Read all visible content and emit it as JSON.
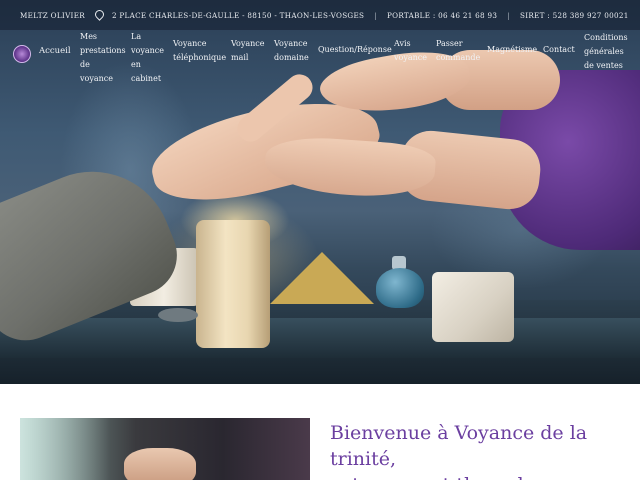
{
  "topbar": {
    "name": "MELTZ OLIVIER",
    "address": "2 PLACE CHARLES-DE-GAULLE - 88150 - THAON-LES-VOSGES",
    "phone": "PORTABLE : 06 46 21 68 93",
    "siret": "SIRET : 528 389 927 00021"
  },
  "nav": {
    "home": "Accueil",
    "items": [
      {
        "lines": [
          "Mes",
          "prestations",
          "de",
          "voyance"
        ]
      },
      {
        "lines": [
          "La",
          "voyance",
          "en",
          "cabinet"
        ]
      },
      {
        "lines": [
          "Voyance",
          "téléphonique"
        ]
      },
      {
        "lines": [
          "Voyance",
          "mail"
        ]
      },
      {
        "lines": [
          "Voyance",
          "domaine"
        ]
      },
      {
        "lines": [
          "Question/Réponse"
        ]
      },
      {
        "lines": [
          "Avis",
          "voyance"
        ]
      },
      {
        "lines": [
          "Passer",
          "commande"
        ]
      },
      {
        "lines": [
          "Magnétisme"
        ]
      },
      {
        "lines": [
          "Contact"
        ]
      },
      {
        "lines": [
          "Conditions",
          "générales",
          "de ventes"
        ]
      }
    ]
  },
  "content": {
    "title_line1": "Bienvenue à Voyance de la trinité,",
    "title_line2": "votre voyant thaon-les-vosges"
  },
  "colors": {
    "accent": "#6b3fa0",
    "topbar_text": "#e9ecf0"
  }
}
